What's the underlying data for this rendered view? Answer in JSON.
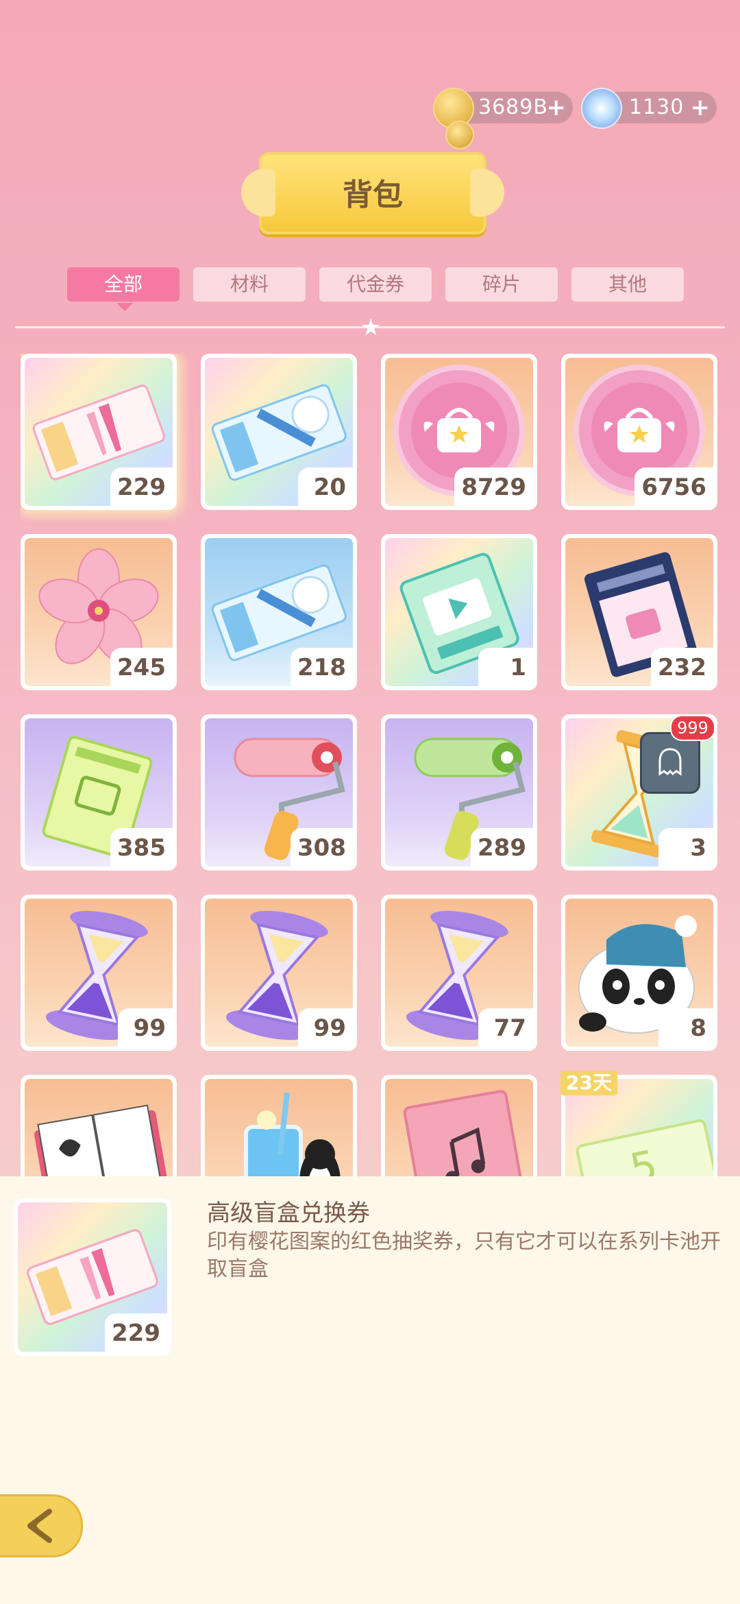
{
  "currency": {
    "coins": "3689B",
    "gems": "1130",
    "plus": "+"
  },
  "title": "背包",
  "tabs": [
    "全部",
    "材料",
    "代金券",
    "碎片",
    "其他"
  ],
  "active_tab": "全部",
  "items": [
    {
      "name": "high-blind-box-ticket",
      "count": "229",
      "bg": "rainbow",
      "icon": "pink-ticket-icon"
    },
    {
      "name": "rainbow-ticket",
      "count": "20",
      "bg": "rainbow",
      "icon": "blue-ticket-icon"
    },
    {
      "name": "pink-coin",
      "count": "8729",
      "bg": "orange",
      "icon": "pink-bag-coin-icon"
    },
    {
      "name": "pink-coin-2",
      "count": "6756",
      "bg": "orange",
      "icon": "pink-bag-coin-icon"
    },
    {
      "name": "sakura-flower",
      "count": "245",
      "bg": "orange",
      "icon": "sakura-icon"
    },
    {
      "name": "blue-ticket",
      "count": "218",
      "bg": "blue",
      "icon": "blue-ticket-icon"
    },
    {
      "name": "video-ticket",
      "count": "1",
      "bg": "rainbow",
      "icon": "video-ticket-icon"
    },
    {
      "name": "dark-ticket",
      "count": "232",
      "bg": "orange",
      "icon": "navy-ticket-icon"
    },
    {
      "name": "green-ticket",
      "count": "385",
      "bg": "purple",
      "icon": "green-ticket-icon"
    },
    {
      "name": "pink-roller",
      "count": "308",
      "bg": "purple",
      "icon": "pink-paint-roller-icon"
    },
    {
      "name": "green-roller",
      "count": "289",
      "bg": "purple",
      "icon": "green-paint-roller-icon"
    },
    {
      "name": "gold-hourglass",
      "count": "3",
      "bg": "rainbow",
      "icon": "golden-hourglass-icon"
    },
    {
      "name": "purple-hourglass-1",
      "count": "99",
      "bg": "orange",
      "icon": "purple-hourglass-icon"
    },
    {
      "name": "purple-hourglass-2",
      "count": "99",
      "bg": "orange",
      "icon": "purple-hourglass-icon"
    },
    {
      "name": "purple-hourglass-3",
      "count": "77",
      "bg": "orange",
      "icon": "purple-hourglass-icon"
    },
    {
      "name": "panda-plush",
      "count": "8",
      "bg": "orange",
      "icon": "panda-icon"
    },
    {
      "name": "book",
      "count": "",
      "bg": "orange",
      "icon": "book-icon"
    },
    {
      "name": "penguin-drink",
      "count": "",
      "bg": "orange",
      "icon": "penguin-drink-icon"
    },
    {
      "name": "music-card",
      "count": "",
      "bg": "orange",
      "icon": "music-card-icon"
    },
    {
      "name": "sale-coupon",
      "count": "",
      "bg": "rainbow",
      "icon": "sale-coupon-icon"
    }
  ],
  "badge_count": "999",
  "days_tag": "23天",
  "detail": {
    "name": "高级盲盒兑换券",
    "description": "印有樱花图案的红色抽奖券，只有它才可以在系列卡池开取盲盒",
    "count": "229"
  },
  "colors": {
    "accent_pink": "#f47aa4",
    "gold": "#f7c83c",
    "badge_red": "#e63c48"
  }
}
